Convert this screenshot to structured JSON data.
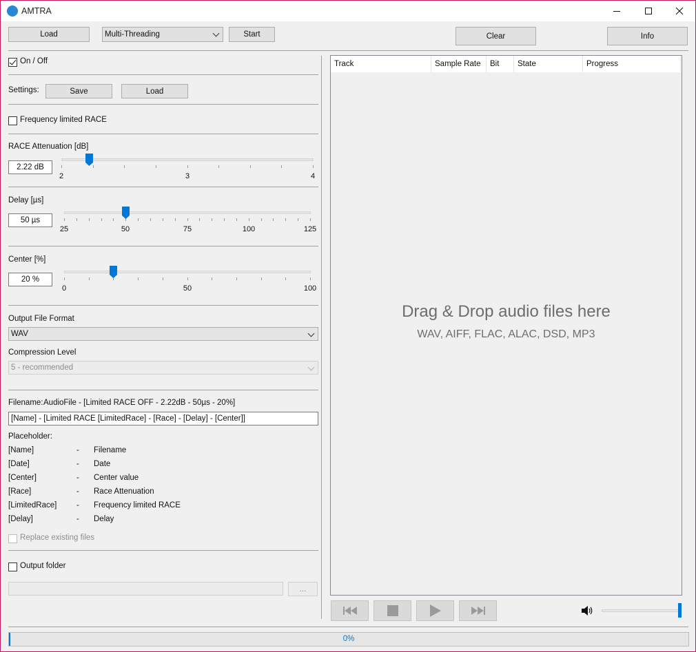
{
  "window": {
    "title": "AMTRA"
  },
  "toolbar": {
    "load_label": "Load",
    "mode_value": "Multi-Threading",
    "start_label": "Start",
    "clear_label": "Clear",
    "info_label": "Info"
  },
  "onoff": {
    "label": "On / Off",
    "checked": true
  },
  "settings": {
    "label": "Settings:",
    "save_label": "Save",
    "load_label": "Load"
  },
  "freq_limited": {
    "label": "Frequency limited RACE",
    "checked": false
  },
  "race": {
    "label": "RACE Attenuation [dB]",
    "value_text": "2.22 dB",
    "value": 2.22,
    "min": 2,
    "max": 4,
    "ticks": [
      "2",
      "3",
      "4"
    ]
  },
  "delay": {
    "label": "Delay [µs]",
    "value_text": "50 µs",
    "value": 50,
    "min": 25,
    "max": 125,
    "ticks": [
      "25",
      "50",
      "75",
      "100",
      "125"
    ]
  },
  "center": {
    "label": "Center [%]",
    "value_text": "20 %",
    "value": 20,
    "min": 0,
    "max": 100,
    "ticks": [
      "0",
      "50",
      "100"
    ]
  },
  "output_format": {
    "label": "Output File Format",
    "value": "WAV"
  },
  "compression": {
    "label": "Compression Level",
    "value": "5 - recommended"
  },
  "filename": {
    "label": "Filename:",
    "preview": "AudioFile - [Limited RACE OFF - 2.22dB - 50µs - 20%]",
    "pattern": "[Name] - [Limited RACE [LimitedRace] - [Race] - [Delay] - [Center]]"
  },
  "placeholder": {
    "label": "Placeholder:",
    "rows": [
      {
        "key": "[Name]",
        "sep": "-",
        "desc": "Filename"
      },
      {
        "key": "[Date]",
        "sep": "-",
        "desc": "Date"
      },
      {
        "key": "[Center]",
        "sep": "-",
        "desc": "Center value"
      },
      {
        "key": "[Race]",
        "sep": "-",
        "desc": "Race Attenuation"
      },
      {
        "key": "[LimitedRace]",
        "sep": "-",
        "desc": "Frequency limited RACE"
      },
      {
        "key": "[Delay]",
        "sep": "-",
        "desc": "Delay"
      }
    ]
  },
  "replace": {
    "label": "Replace existing files",
    "checked": false
  },
  "output_folder": {
    "label": "Output folder",
    "checked": false,
    "path": "",
    "browse_label": "..."
  },
  "tracklist": {
    "columns": [
      "Track",
      "Sample Rate",
      "Bit",
      "State",
      "Progress"
    ],
    "drop_title": "Drag & Drop audio files here",
    "drop_formats": "WAV, AIFF, FLAC, ALAC, DSD, MP3"
  },
  "player": {
    "volume": 1.0
  },
  "progress": {
    "text": "0%",
    "value": 0
  },
  "colors": {
    "accent": "#0078d7",
    "frame": "#c2185b"
  }
}
